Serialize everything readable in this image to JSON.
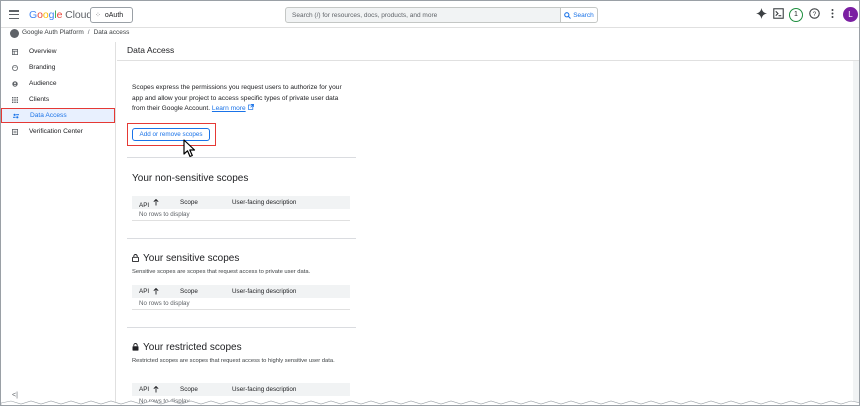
{
  "header": {
    "logo_google": [
      "G",
      "o",
      "o",
      "g",
      "l",
      "e"
    ],
    "logo_cloud": "Cloud",
    "project_name": "oAuth",
    "search_placeholder": "Search (/) for resources, docs, products, and more",
    "search_button": "Search",
    "notification_count": "1",
    "avatar_letter": "L"
  },
  "breadcrumb": {
    "root": "Google Auth Platform",
    "separator": "/",
    "current": "Data access"
  },
  "sidebar": {
    "items": [
      {
        "label": "Overview",
        "icon": "overview-icon"
      },
      {
        "label": "Branding",
        "icon": "palette-icon"
      },
      {
        "label": "Audience",
        "icon": "people-icon"
      },
      {
        "label": "Clients",
        "icon": "grid-icon"
      },
      {
        "label": "Data Access",
        "icon": "data-access-icon",
        "active": true
      },
      {
        "label": "Verification Center",
        "icon": "checklist-icon"
      }
    ],
    "collapse_glyph": "<|"
  },
  "page": {
    "title": "Data Access",
    "intro": "Scopes express the permissions you request users to authorize for your app and allow your project to access specific types of private user data from their Google Account.",
    "learn_more": "Learn more",
    "add_button": "Add or remove scopes"
  },
  "sections": {
    "nonsensitive": {
      "title": "Your non-sensitive scopes",
      "columns": [
        "API",
        "Scope",
        "User-facing description"
      ],
      "empty": "No rows to display"
    },
    "sensitive": {
      "title": "Your sensitive scopes",
      "subtitle": "Sensitive scopes are scopes that request access to private user data.",
      "columns": [
        "API",
        "Scope",
        "User-facing description"
      ],
      "empty": "No rows to display"
    },
    "restricted": {
      "title": "Your restricted scopes",
      "subtitle": "Restricted scopes are scopes that request access to highly sensitive user data.",
      "columns": [
        "API",
        "Scope",
        "User-facing description"
      ],
      "empty": "No rows to display"
    }
  },
  "colors": {
    "accent": "#1a73e8",
    "highlight": "#e53935",
    "avatar": "#7b1fa2"
  }
}
